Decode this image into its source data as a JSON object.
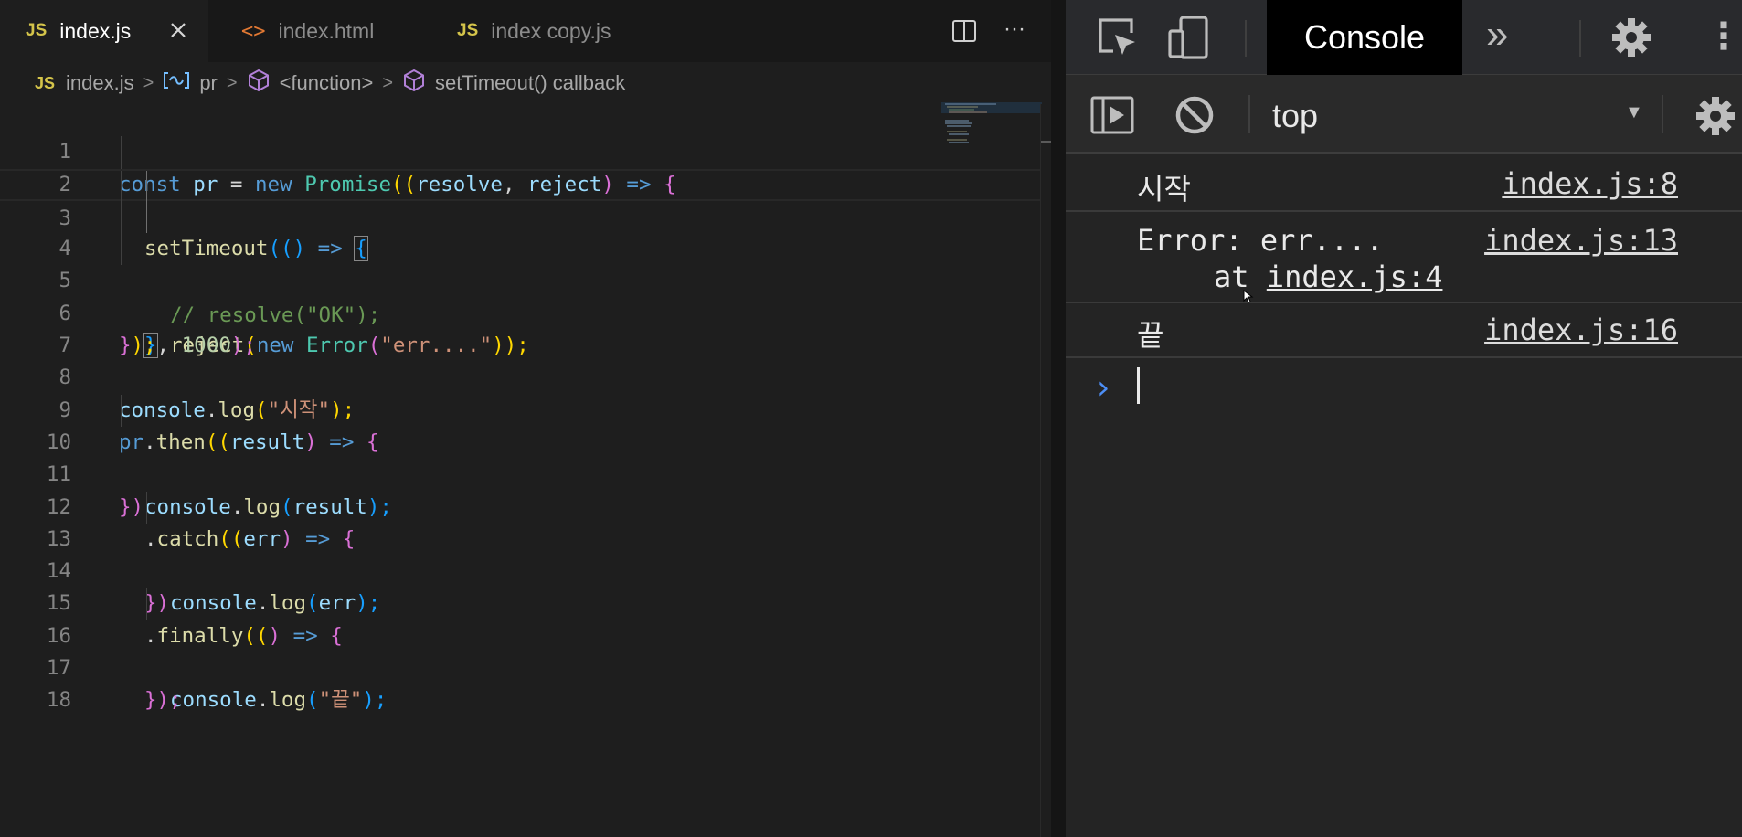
{
  "editor": {
    "tabs": [
      {
        "badge": "JS",
        "label": "index.js",
        "active": true
      },
      {
        "badge": "<>",
        "label": "index.html",
        "active": false
      },
      {
        "badge": "JS",
        "label": "index copy.js",
        "active": false
      }
    ],
    "close_glyph": "✕",
    "actions": [
      {
        "icon": "split-editor-icon"
      },
      {
        "icon": "more-actions-icon",
        "glyph": "···"
      }
    ],
    "breadcrumb": {
      "file_badge": "JS",
      "items": [
        "index.js",
        "pr",
        "<function>",
        "setTimeout() callback"
      ],
      "separator": ">"
    },
    "line_numbers": [
      "1",
      "2",
      "3",
      "4",
      "5",
      "6",
      "7",
      "8",
      "9",
      "10",
      "11",
      "12",
      "13",
      "14",
      "15",
      "16",
      "17",
      "18"
    ],
    "code": {
      "l1": {
        "a": "const",
        "b": "pr",
        "c": "=",
        "d": "new",
        "e": "Promise",
        "f": "((",
        "g": "resolve",
        "h": ", ",
        "i": "reject",
        "j": ")",
        "k": "=>",
        "m": "{"
      },
      "l2": {
        "a": "setTimeout",
        "b": "((",
        "c": ")",
        "d": "=>",
        "e": "{"
      },
      "l3": {
        "a": "// resolve(\"OK\");"
      },
      "l4": {
        "a": "reject",
        "b": "(",
        "c": "new",
        "d": "Error",
        "e": "(",
        "f": "\"err....\"",
        "g": "));"
      },
      "l5": {
        "a": "}",
        "b": ", ",
        "c": "1000",
        "d": ");"
      },
      "l6": {
        "a": "}",
        "b": ");"
      },
      "l8": {
        "a": "console",
        "b": ".",
        "c": "log",
        "d": "(",
        "e": "\"시작\"",
        "f": ");"
      },
      "l9": {
        "a": "pr",
        "b": ".",
        "c": "then",
        "d": "((",
        "e": "result",
        "f": ")",
        "g": "=>",
        "h": "{"
      },
      "l10": {
        "a": "console",
        "b": ".",
        "c": "log",
        "d": "(",
        "e": "result",
        "f": ");"
      },
      "l11": {
        "a": "})"
      },
      "l12": {
        "a": ".",
        "b": "catch",
        "c": "((",
        "d": "err",
        "e": ")",
        "f": "=>",
        "g": "{"
      },
      "l13": {
        "a": "console",
        "b": ".",
        "c": "log",
        "d": "(",
        "e": "err",
        "f": ");"
      },
      "l14": {
        "a": "})"
      },
      "l15": {
        "a": ".",
        "b": "finally",
        "c": "((",
        "d": ")",
        "e": "=>",
        "f": "{"
      },
      "l16": {
        "a": "console",
        "b": ".",
        "c": "log",
        "d": "(",
        "e": "\"끝\"",
        "f": ");"
      },
      "l17": {
        "a": "});"
      }
    }
  },
  "devtools": {
    "toolbar": {
      "inspect_icon": "inspect-element-icon",
      "device_icon": "device-toolbar-icon",
      "active_tab": "Console",
      "more_tabs_glyph": "»",
      "settings_icon": "gear-icon",
      "menu_glyph": "⋮"
    },
    "filter_bar": {
      "sidebar_icon": "show-sidebar-icon",
      "clear_icon": "clear-console-icon",
      "context": "top",
      "context_caret": "▼",
      "settings_icon": "gear-icon"
    },
    "messages": [
      {
        "text": "시작",
        "source": "index.js:8"
      },
      {
        "text": "Error: err....",
        "stack_prefix": "at ",
        "stack_link": "index.js:4",
        "source": "index.js:13"
      },
      {
        "text": "끝",
        "source": "index.js:16"
      }
    ],
    "prompt_glyph": "›"
  },
  "colors": {
    "editor_bg": "#1e1e1e",
    "tabbar_bg": "#181818",
    "devtools_bg": "#242424",
    "js_badge": "#d4c44a",
    "html_badge": "#e37933",
    "prompt": "#4d8ff7"
  }
}
